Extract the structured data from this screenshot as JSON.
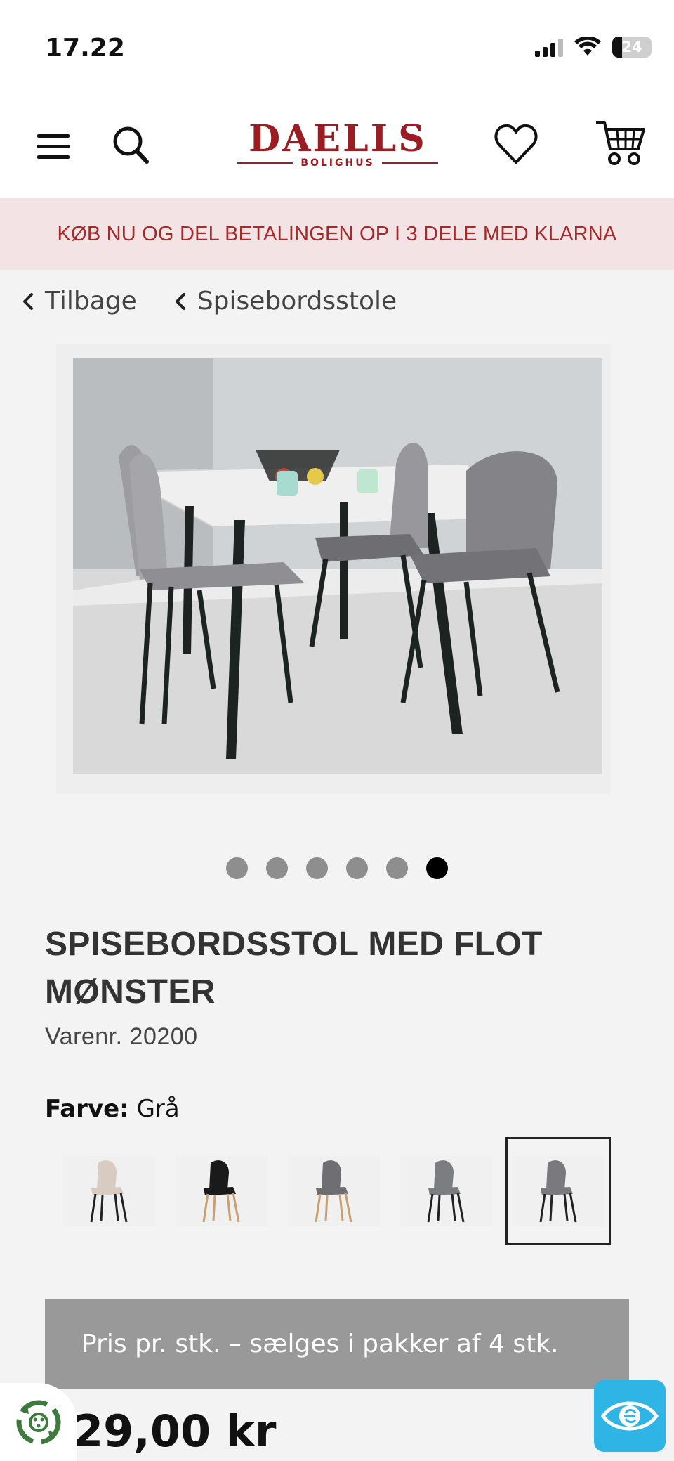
{
  "status_bar": {
    "time": "17.22",
    "battery": "24"
  },
  "header": {
    "brand": "DAELLS",
    "brand_sub": "BOLIGHUS"
  },
  "promo": {
    "text": "KØB NU OG DEL BETALINGEN OP I 3 DELE MED KLARNA"
  },
  "breadcrumbs": [
    {
      "label": "Tilbage"
    },
    {
      "label": "Spisebordsstole"
    }
  ],
  "gallery": {
    "slide_count": 6,
    "active_index": 5
  },
  "product": {
    "title": "SPISEBORDSSTOL MED FLOT MØNSTER",
    "sku": "Varenr. 20200",
    "color_label": "Farve:",
    "color_value": "Grå",
    "swatches": [
      {
        "color": "#d8ccc2",
        "legs": "#222"
      },
      {
        "color": "#1a1a1a",
        "legs": "#c8a070"
      },
      {
        "color": "#6e6e73",
        "legs": "#c8a070"
      },
      {
        "color": "#7b7d80",
        "legs": "#222"
      },
      {
        "color": "#7a7a7e",
        "legs": "#222"
      }
    ],
    "selected_swatch": 4,
    "notice": "Pris pr. stk. – sælges i pakker af 4 stk.",
    "price": "29,00 kr"
  },
  "colors": {
    "brand": "#9b1c22",
    "promo_bg": "#f3e3e4",
    "promo_text": "#a52a2a",
    "accessibility_button": "#2fb4e6"
  }
}
